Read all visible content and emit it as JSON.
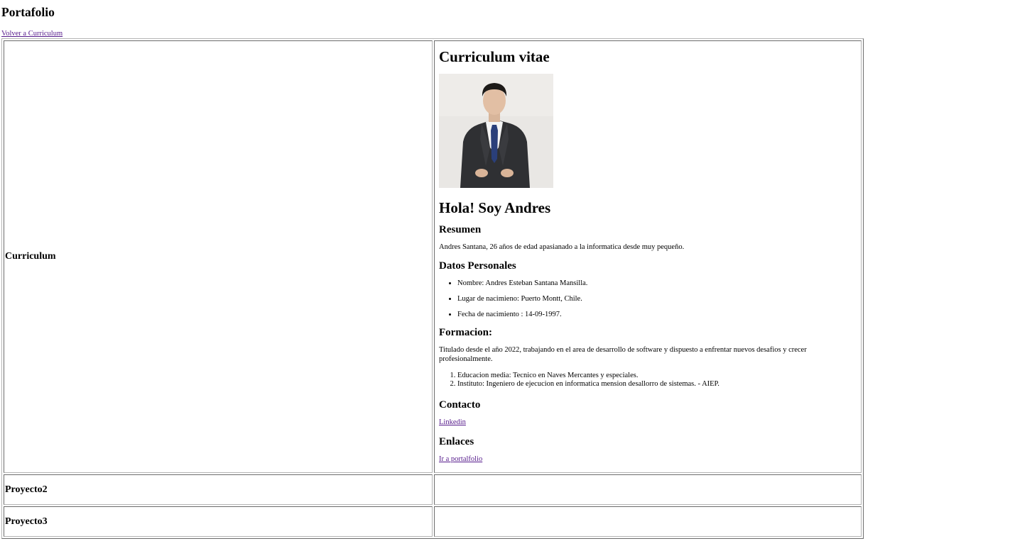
{
  "page": {
    "title": "Portafolio",
    "back_link": "Volver a Curriculum"
  },
  "rows": [
    {
      "label": "Curriculum"
    },
    {
      "label": "Proyecto2"
    },
    {
      "label": "Proyecto3"
    }
  ],
  "cv": {
    "title": "Curriculum vitae",
    "greeting": "Hola! Soy Andres",
    "summary_heading": "Resumen",
    "summary_text": "Andres Santana, 26 años de edad apasianado a la informatica desde muy pequeño.",
    "personal_heading": "Datos Personales",
    "personal_items": [
      "Nombre: Andres Esteban Santana Mansilla.",
      "Lugar de nacimieno: Puerto Montt, Chile.",
      "Fecha de nacimiento : 14-09-1997."
    ],
    "education_heading": "Formacion:",
    "education_text": "Titulado desde el año 2022, trabajando en el area de desarrollo de software y dispuesto a enfrentar nuevos desafios y crecer profesionalmente.",
    "education_items": [
      "Educacion media: Tecnico en Naves Mercantes y especiales.",
      "Instituto: Ingeniero de ejecucion en informatica mension desallorro de sistemas. - AIEP."
    ],
    "contact_heading": "Contacto",
    "contact_link": "Linkedin ",
    "links_heading": "Enlaces",
    "portfolio_link": "Ir a portalfolio"
  },
  "colors": {
    "link_visited": "#551a8b",
    "photo_background": "#e8e6e3",
    "suit": "#2f3033",
    "tie": "#2a3f7a"
  }
}
